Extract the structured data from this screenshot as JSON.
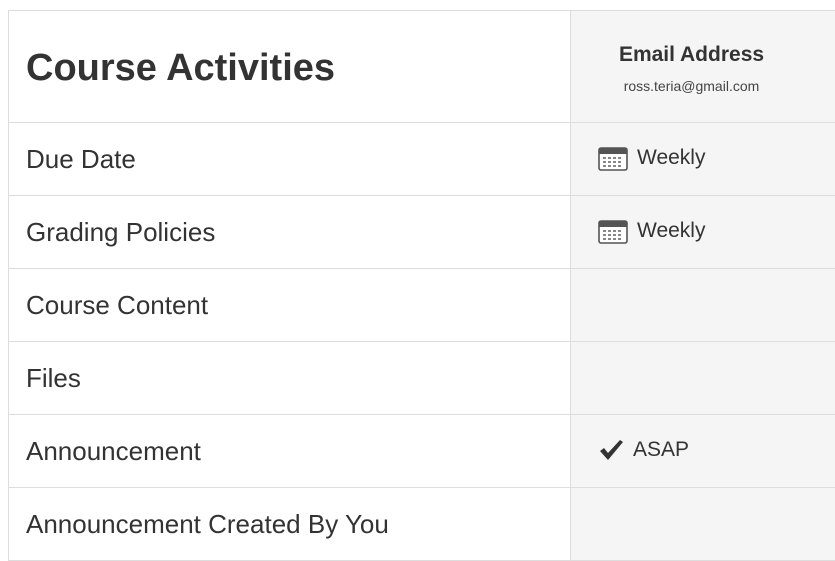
{
  "table": {
    "heading": "Course Activities",
    "column": {
      "title": "Email Address",
      "email": "ross.teria@gmail.com"
    },
    "rows": [
      {
        "label": "Due Date",
        "value": "Weekly",
        "icon": "calendar-icon"
      },
      {
        "label": "Grading Policies",
        "value": "Weekly",
        "icon": "calendar-icon"
      },
      {
        "label": "Course Content",
        "value": "",
        "icon": ""
      },
      {
        "label": "Files",
        "value": "",
        "icon": ""
      },
      {
        "label": "Announcement",
        "value": "ASAP",
        "icon": "check-icon"
      },
      {
        "label": "Announcement Created By You",
        "value": "",
        "icon": ""
      }
    ]
  },
  "colors": {
    "border": "#dddddd",
    "value_column_bg": "#f5f5f5",
    "text": "#333333"
  }
}
